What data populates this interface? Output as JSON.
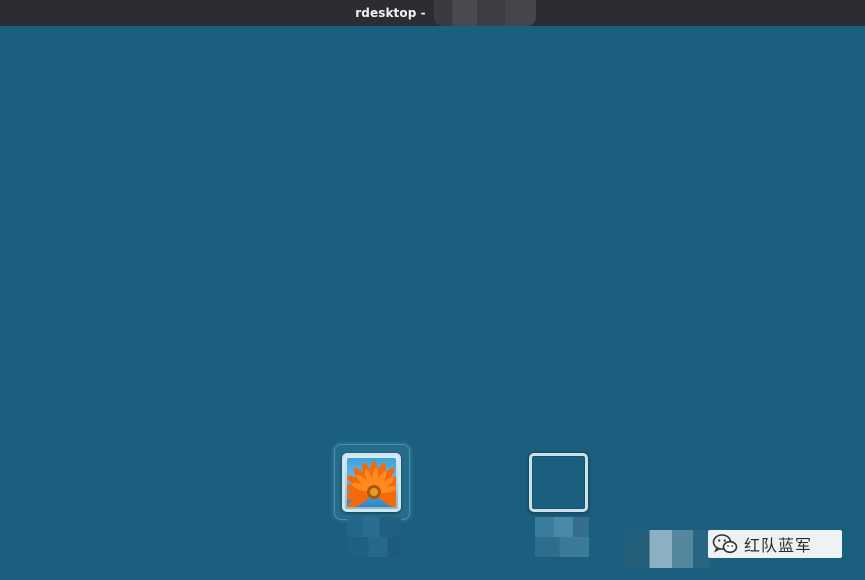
{
  "window": {
    "title": "rdesktop -"
  },
  "logon": {
    "users": [
      {
        "avatar": "flower-icon",
        "selected": true
      },
      {
        "avatar": "blank",
        "selected": false
      }
    ]
  },
  "watermark": {
    "icon": "wechat-icon",
    "text": "红队蓝军"
  },
  "colors": {
    "titlebar": "#2c2d32",
    "desktop": "#1a5f7d",
    "frame": "#cfe6ee"
  }
}
